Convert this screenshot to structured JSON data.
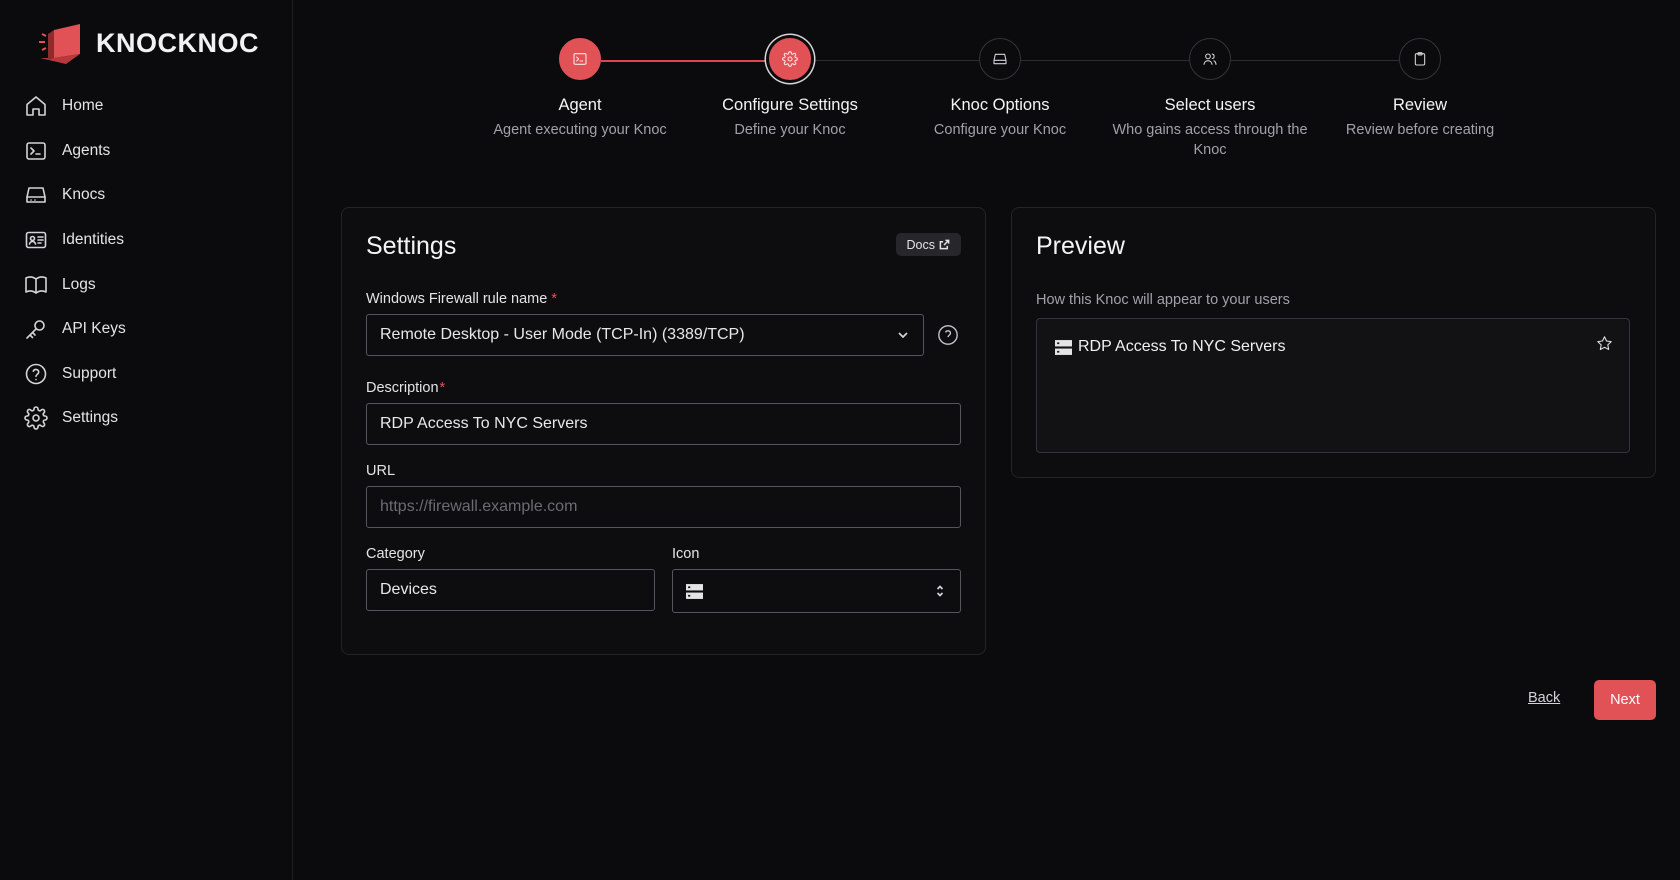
{
  "brand": {
    "name": "KNOCKNOC",
    "accent": "#e05256"
  },
  "sidebar": {
    "items": [
      {
        "label": "Home",
        "icon": "home-icon"
      },
      {
        "label": "Agents",
        "icon": "terminal-icon"
      },
      {
        "label": "Knocs",
        "icon": "hard-drive-icon"
      },
      {
        "label": "Identities",
        "icon": "id-card-icon"
      },
      {
        "label": "Logs",
        "icon": "book-icon"
      },
      {
        "label": "API Keys",
        "icon": "key-icon"
      },
      {
        "label": "Support",
        "icon": "help-circle-icon"
      },
      {
        "label": "Settings",
        "icon": "gear-icon"
      }
    ]
  },
  "stepper": {
    "steps": [
      {
        "title": "Agent",
        "subtitle": "Agent executing your Knoc",
        "state": "done",
        "icon": "terminal-icon"
      },
      {
        "title": "Configure Settings",
        "subtitle": "Define your Knoc",
        "state": "current",
        "icon": "gear-icon"
      },
      {
        "title": "Knoc Options",
        "subtitle": "Configure your Knoc",
        "state": "pending",
        "icon": "hard-drive-icon"
      },
      {
        "title": "Select users",
        "subtitle": "Who gains access through the Knoc",
        "state": "pending",
        "icon": "users-icon"
      },
      {
        "title": "Review",
        "subtitle": "Review before creating",
        "state": "pending",
        "icon": "clipboard-icon"
      }
    ]
  },
  "settings": {
    "title": "Settings",
    "docs_label": "Docs",
    "rule_name": {
      "label": "Windows Firewall rule name",
      "required_mark": "*",
      "value": "Remote Desktop - User Mode (TCP-In) (3389/TCP)"
    },
    "description": {
      "label": "Description",
      "required_mark": "*",
      "value": "RDP Access To NYC Servers"
    },
    "url": {
      "label": "URL",
      "placeholder": "https://firewall.example.com",
      "value": ""
    },
    "category": {
      "label": "Category",
      "value": "Devices"
    },
    "icon": {
      "label": "Icon",
      "value": "server-icon"
    }
  },
  "preview": {
    "title": "Preview",
    "subtitle": "How this Knoc will appear to your users",
    "item_name": "RDP Access To NYC Servers",
    "item_icon": "server-icon"
  },
  "actions": {
    "back_label": "Back",
    "next_label": "Next"
  }
}
